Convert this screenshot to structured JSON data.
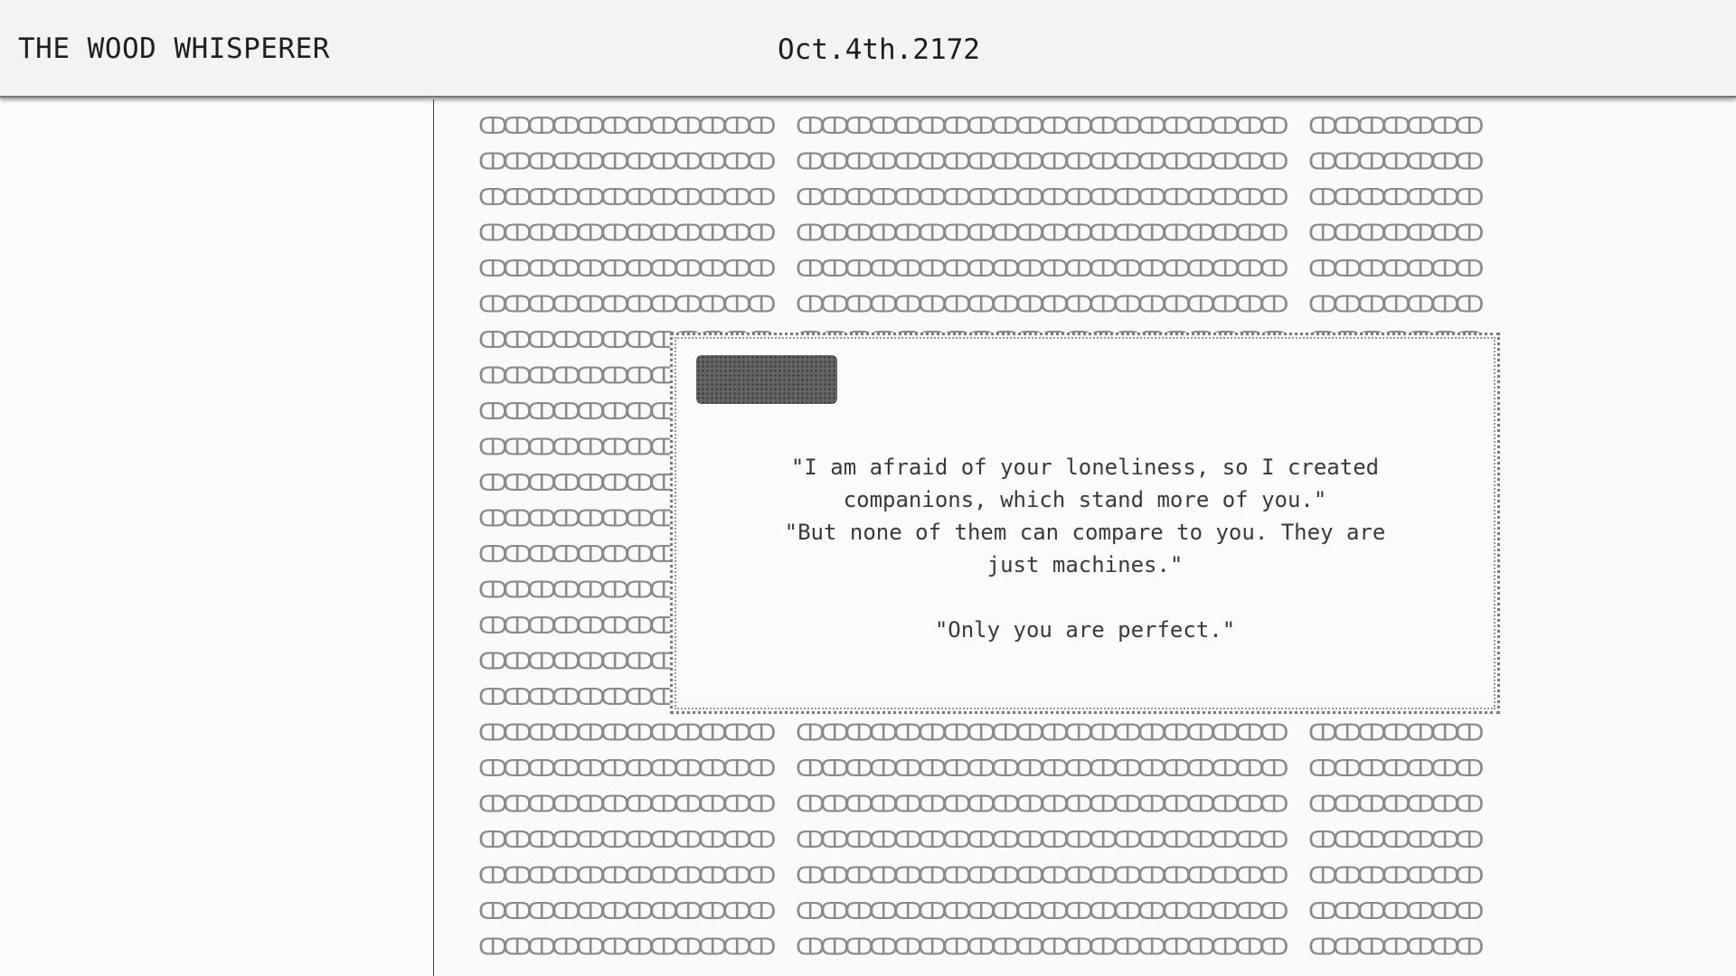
{
  "header": {
    "title": "THE WOOD WHISPERER",
    "date": "Oct.4th.2172"
  },
  "dialog": {
    "speaker_blot_icon": "ink-blot-icon",
    "lines": [
      "\"I am afraid of your loneliness, so I created companions, which stand more of you.\"",
      "\"But none of them can compare to you. They are just machines.\"",
      "\"Only you are perfect.\""
    ]
  },
  "field": {
    "glyph": "ↀ",
    "pattern_icon": "dotted-glyph-pattern"
  },
  "colors": {
    "background": "#fafafa",
    "text": "#2a2a2a",
    "glyph": "#8a8a8a",
    "border": "#777777"
  }
}
